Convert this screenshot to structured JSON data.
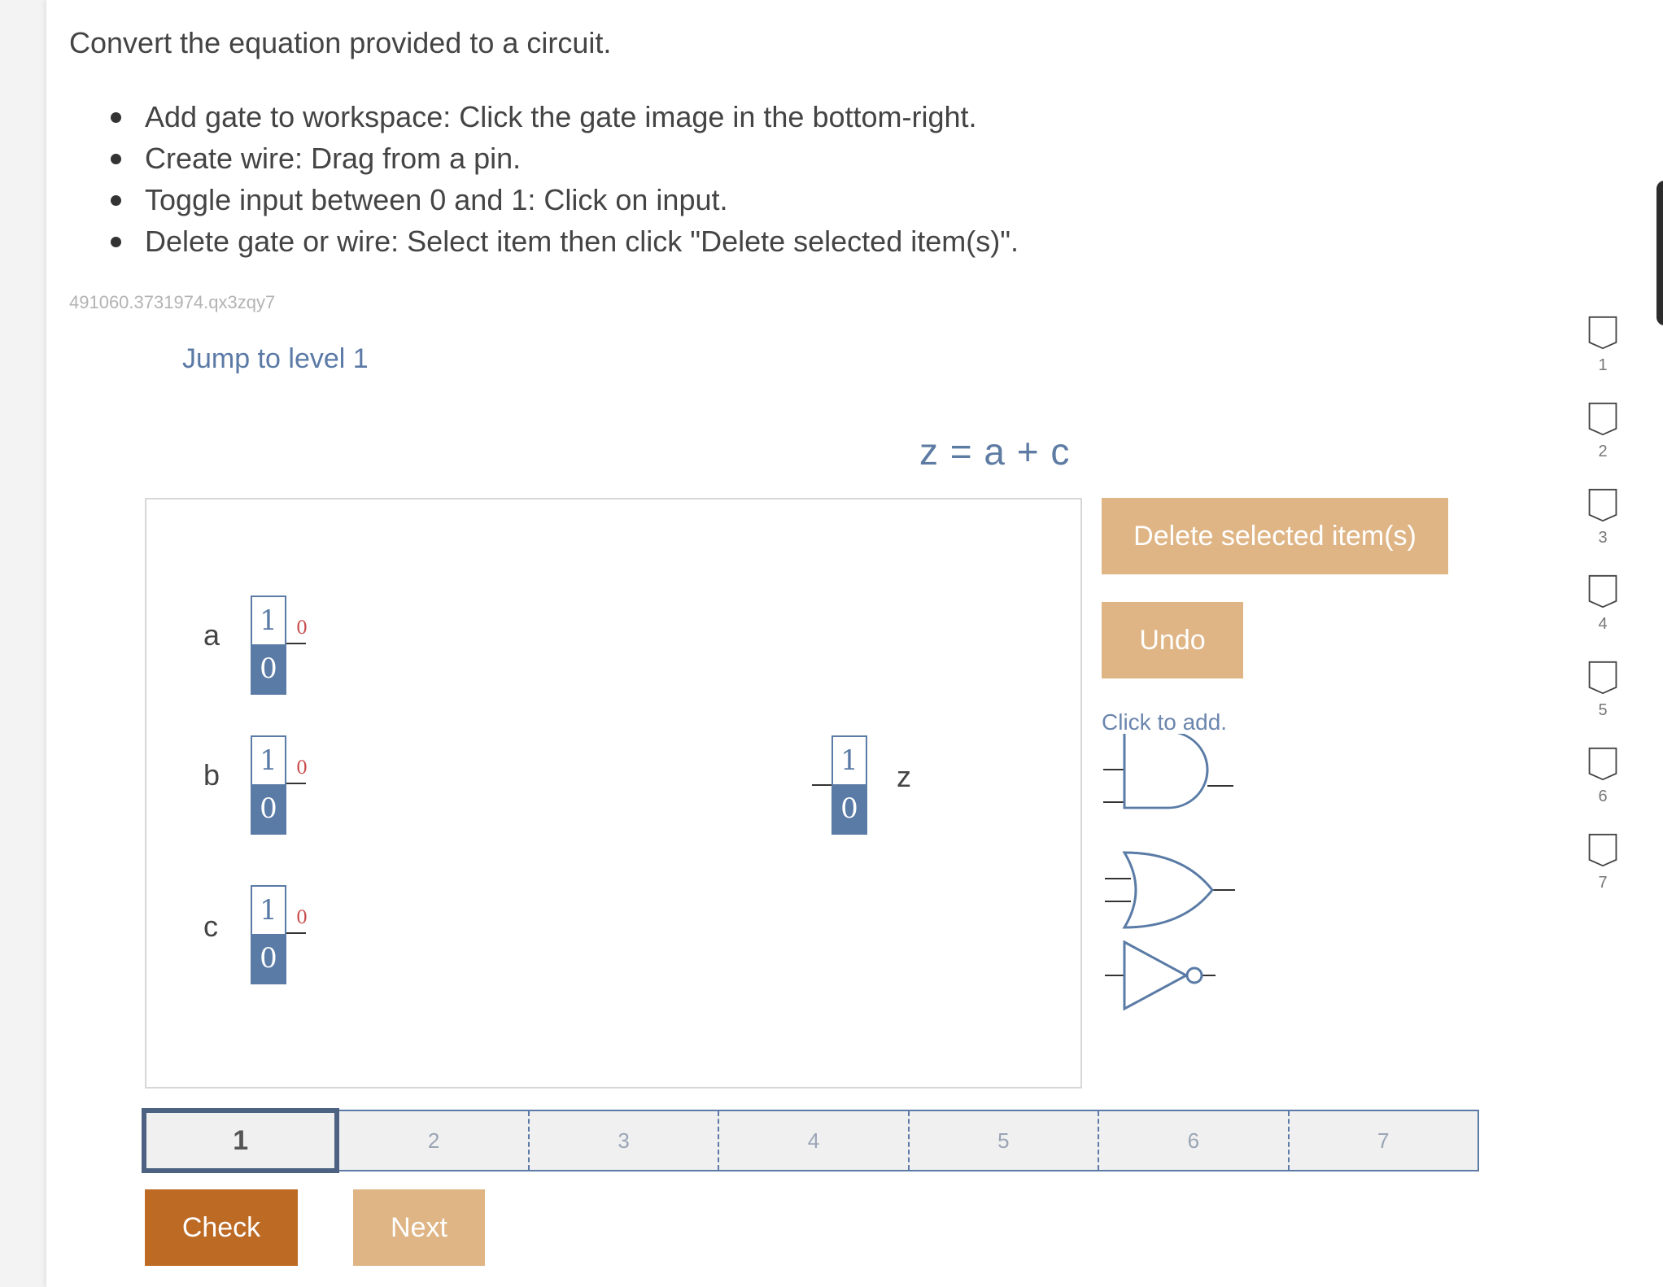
{
  "instructions": {
    "title": "Convert the equation provided to a circuit.",
    "bullets": [
      "Add gate to workspace: Click the gate image in the bottom-right.",
      "Create wire: Drag from a pin.",
      "Toggle input between 0 and 1: Click on input.",
      "Delete gate or wire: Select item then click \"Delete selected item(s)\"."
    ]
  },
  "activity_id": "491060.3731974.qx3zqy7",
  "jump_link": "Jump to level 1",
  "equation": "z = a + c",
  "workspace": {
    "inputs": [
      {
        "label": "a",
        "one": "1",
        "zero": "0",
        "pin_value": "0"
      },
      {
        "label": "b",
        "one": "1",
        "zero": "0",
        "pin_value": "0"
      },
      {
        "label": "c",
        "one": "1",
        "zero": "0",
        "pin_value": "0"
      }
    ],
    "output": {
      "label": "z",
      "one": "1",
      "zero": "0"
    }
  },
  "buttons": {
    "delete": "Delete selected item(s)",
    "undo": "Undo",
    "check": "Check",
    "next": "Next"
  },
  "gate_palette": {
    "hint": "Click to add.",
    "gates": [
      "and-gate-icon",
      "or-gate-icon",
      "not-gate-icon"
    ]
  },
  "progress": {
    "levels": [
      "1",
      "2",
      "3",
      "4",
      "5",
      "6",
      "7"
    ],
    "current": "1"
  },
  "side_levels": [
    "1",
    "2",
    "3",
    "4",
    "5",
    "6",
    "7"
  ],
  "colors": {
    "accent_blue": "#5a7ba6",
    "button_light": "#dfb585",
    "button_dark": "#bd6a25",
    "pin_red": "#c94c4c"
  }
}
